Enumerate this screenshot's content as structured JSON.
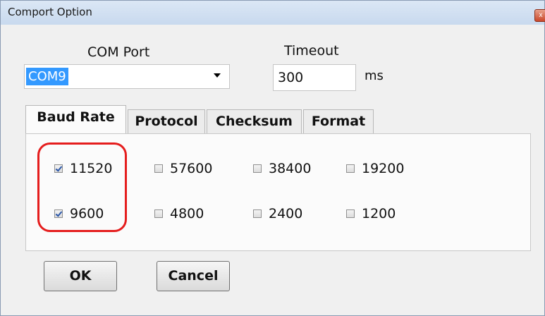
{
  "window": {
    "title": "Comport Option",
    "close_glyph": "x"
  },
  "com_port": {
    "label": "COM Port",
    "value": "COM9"
  },
  "timeout": {
    "label": "Timeout",
    "value": "300",
    "unit": "ms"
  },
  "tabs": [
    {
      "label": "Baud Rate",
      "active": true
    },
    {
      "label": "Protocol",
      "active": false
    },
    {
      "label": "Checksum",
      "active": false
    },
    {
      "label": "Format",
      "active": false
    }
  ],
  "baud_rates": [
    {
      "label": "11520",
      "checked": true
    },
    {
      "label": "57600",
      "checked": false
    },
    {
      "label": "38400",
      "checked": false
    },
    {
      "label": "19200",
      "checked": false
    },
    {
      "label": "9600",
      "checked": true
    },
    {
      "label": "4800",
      "checked": false
    },
    {
      "label": "2400",
      "checked": false
    },
    {
      "label": "1200",
      "checked": false
    }
  ],
  "buttons": {
    "ok": "OK",
    "cancel": "Cancel"
  },
  "colors": {
    "selection": "#3399ff",
    "highlight_ring": "#e51d1d",
    "titlebar": "#dbe7f5"
  },
  "icons": {
    "dropdown": "chevron-down-icon",
    "close": "close-icon"
  }
}
